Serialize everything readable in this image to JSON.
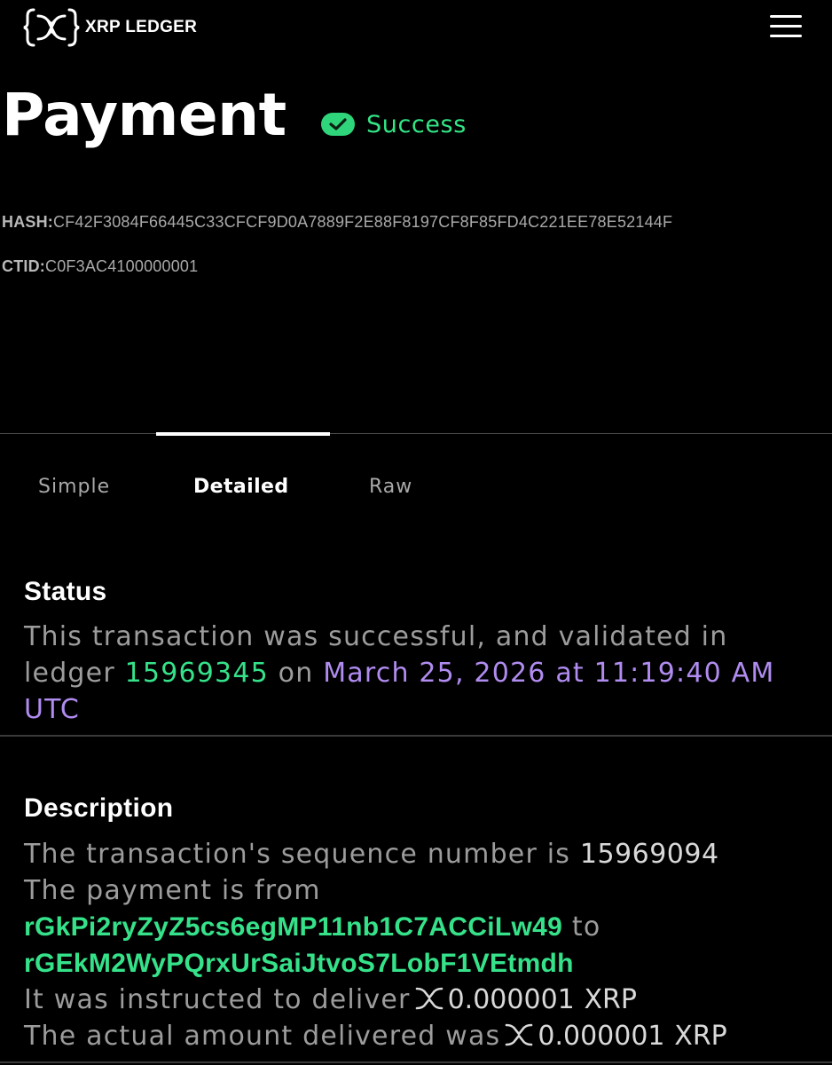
{
  "header": {
    "logo_text": "XRP LEDGER",
    "logo_icon": "xrp-logo-icon",
    "menu_icon": "hamburger-menu-icon"
  },
  "transaction": {
    "type": "Payment",
    "status": "Success",
    "status_icon": "check-circle-icon",
    "hash_label": "HASH:",
    "hash_value": "CF42F3084F66445C33CFCF9D0A7889F2E88F8197CF8F85FD4C221EE78E52144F",
    "ctid_label": "CTID:",
    "ctid_value": "C0F3AC4100000001"
  },
  "tabs": [
    {
      "label": "Simple",
      "active": false
    },
    {
      "label": "Detailed",
      "active": true
    },
    {
      "label": "Raw",
      "active": false
    }
  ],
  "status_section": {
    "heading": "Status",
    "text_1": "This transaction was successful, and validated in ledger",
    "ledger_index": "15969345",
    "text_2": "on",
    "date": "March 25, 2026 at 11:19:40 AM UTC"
  },
  "description_section": {
    "heading": "Description",
    "sequence_text": "The transaction's sequence number is",
    "sequence_number": "15969094",
    "from_text": "The payment is from",
    "from_account": "rGkPi2ryZyZ5cs6egMP11nb1C7ACCiLw49",
    "to_text": "to",
    "to_account": "rGEkM2WyPQrxUrSaiJtvoS7LobF1VEtmdh",
    "deliver_text": "It was instructed to deliver",
    "deliver_amount": "0.000001",
    "deliver_currency": "XRP",
    "delivered_text": "The actual amount delivered was",
    "delivered_amount": "0.000001",
    "delivered_currency": "XRP",
    "currency_icon": "xrp-icon"
  },
  "colors": {
    "background": "#000000",
    "success_green": "#32e685",
    "link_green": "#35e28a",
    "date_purple": "#b08cf0",
    "muted_text": "#9c9c9c"
  }
}
